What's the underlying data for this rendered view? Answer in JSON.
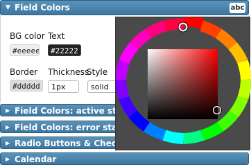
{
  "main_panel": {
    "title": "Field Colors",
    "badge": "abc",
    "labels": {
      "bg_color": "BG color",
      "text": "Text",
      "border": "Border",
      "thickness": "Thickness",
      "style": "Style"
    },
    "values": {
      "bg_color": "#eeeeee",
      "text_color": "#22222",
      "border_color": "#ddddd",
      "thickness": "1px",
      "style": "solid"
    }
  },
  "collapsed_panels": [
    {
      "title": "Field Colors: active state"
    },
    {
      "title": "Field Colors: error state"
    },
    {
      "title": "Radio Buttons & Check Boxes"
    },
    {
      "title": "Calendar"
    }
  ],
  "colors": {
    "header": "#4682b0",
    "picker_bg": "#4a4a4a",
    "selected_hue": "#ff0000"
  }
}
